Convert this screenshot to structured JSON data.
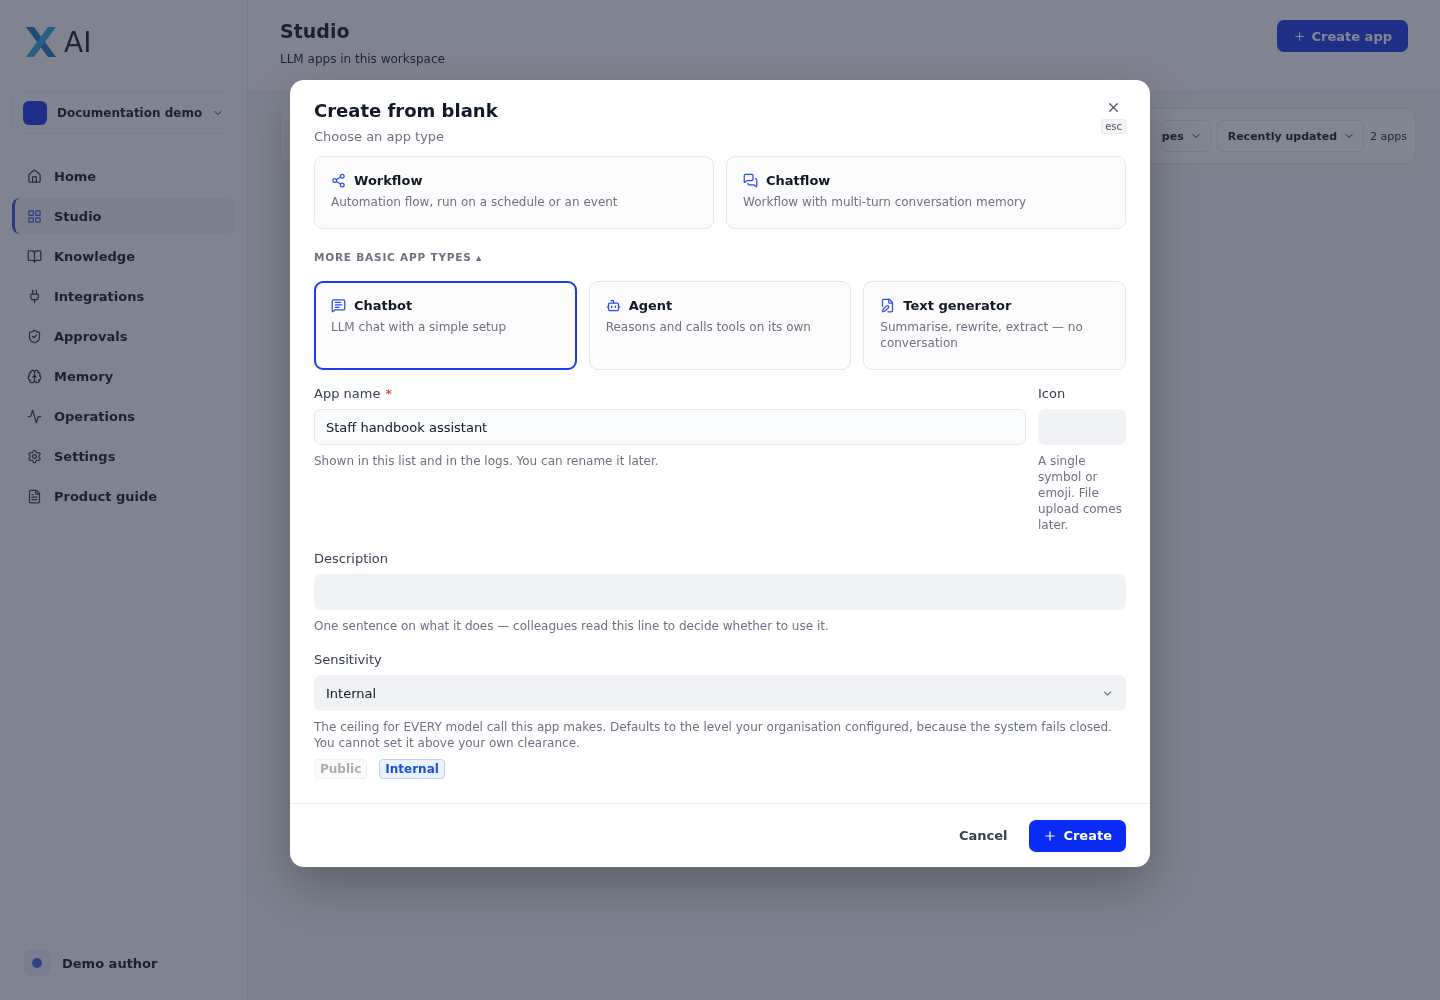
{
  "background": {
    "logo": {
      "text": "AI"
    },
    "workspace": {
      "name": "Documentation demo"
    },
    "nav": [
      {
        "label": "Home",
        "selected": false
      },
      {
        "label": "Studio",
        "selected": true
      },
      {
        "label": "Knowledge",
        "selected": false
      },
      {
        "label": "Integrations",
        "selected": false
      },
      {
        "label": "Approvals",
        "selected": false
      },
      {
        "label": "Memory",
        "selected": false
      },
      {
        "label": "Operations",
        "selected": false
      },
      {
        "label": "Settings",
        "selected": false
      },
      {
        "label": "Product guide",
        "selected": false
      }
    ],
    "user": {
      "name": "Demo author"
    },
    "page": {
      "title": "Studio",
      "subtitle": "LLM apps in this workspace",
      "create_button": "Create app"
    },
    "filters": {
      "type_filter": "pes",
      "sort": "Recently updated",
      "count": "2 apps"
    }
  },
  "dialog": {
    "title": "Create from blank",
    "subtitle": "Choose an app type",
    "close_hint": "esc",
    "primary_types": [
      {
        "kind": "workflow",
        "name": "Workflow",
        "description": "Automation flow, run on a schedule or an event",
        "selected": false
      },
      {
        "kind": "chatflow",
        "name": "Chatflow",
        "description": "Workflow with multi-turn conversation memory",
        "selected": false
      }
    ],
    "more_toggle": {
      "label": "MORE BASIC APP TYPES ▴",
      "expanded": true
    },
    "basic_types": [
      {
        "kind": "chatbot",
        "name": "Chatbot",
        "description": "LLM chat with a simple setup",
        "selected": true
      },
      {
        "kind": "agent",
        "name": "Agent",
        "description": "Reasons and calls tools on its own",
        "selected": false
      },
      {
        "kind": "text",
        "name": "Text generator",
        "description": "Summarise, rewrite, extract — no conversation",
        "selected": false
      }
    ],
    "app_name": {
      "label": "App name",
      "required_mark": "*",
      "value": "Staff handbook assistant",
      "hint": "Shown in this list and in the logs. You can rename it later."
    },
    "icon": {
      "label": "Icon",
      "hint": "A single symbol or emoji. File upload comes later."
    },
    "description": {
      "label": "Description",
      "hint": "One sentence on what it does — colleagues read this line to decide whether to use it."
    },
    "sensitivity": {
      "label": "Sensitivity",
      "value": "Internal",
      "hint": "The ceiling for EVERY model call this app makes. Defaults to the level your organisation configured, because the system fails closed. You cannot set it above your own clearance.",
      "levels": [
        {
          "label": "Public",
          "selected": false
        },
        {
          "label": "Internal",
          "selected": true
        }
      ]
    },
    "buttons": {
      "cancel": "Cancel",
      "create": "Create"
    }
  }
}
